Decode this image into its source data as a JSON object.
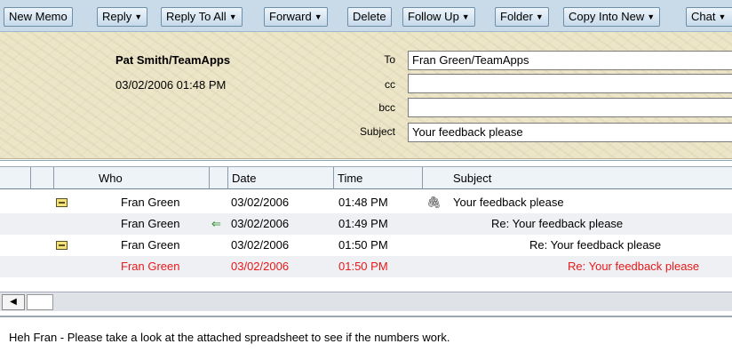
{
  "toolbar": {
    "buttons": [
      {
        "label": "New Memo",
        "dropdown": false
      },
      {
        "label": "Reply",
        "dropdown": true
      },
      {
        "label": "Reply To All",
        "dropdown": true
      },
      {
        "label": "Forward",
        "dropdown": true
      },
      {
        "label": "Delete",
        "dropdown": false
      },
      {
        "label": "Follow Up",
        "dropdown": true
      },
      {
        "label": "Folder",
        "dropdown": true
      },
      {
        "label": "Copy Into New",
        "dropdown": true
      },
      {
        "label": "Chat",
        "dropdown": true
      }
    ]
  },
  "memo": {
    "from": "Pat Smith/TeamApps",
    "sent": "03/02/2006 01:48 PM",
    "to_label": "To",
    "to_value": "Fran Green/TeamApps",
    "cc_label": "cc",
    "cc_value": "",
    "bcc_label": "bcc",
    "bcc_value": "",
    "subject_label": "Subject",
    "subject_value": "Your feedback please"
  },
  "thread": {
    "columns": [
      "Who",
      "Date",
      "Time",
      "Subject"
    ],
    "rows": [
      {
        "who": "Fran Green",
        "date": "03/02/2006",
        "time": "01:48 PM",
        "subject": "Your feedback please",
        "unread_icon": true,
        "reply_icon": false,
        "attachment": true,
        "highlight": false
      },
      {
        "who": "Fran Green",
        "date": "03/02/2006",
        "time": "01:49 PM",
        "subject": "Re: Your feedback please",
        "unread_icon": false,
        "reply_icon": true,
        "attachment": false,
        "highlight": false
      },
      {
        "who": "Fran Green",
        "date": "03/02/2006",
        "time": "01:50 PM",
        "subject": "Re: Your feedback please",
        "unread_icon": true,
        "reply_icon": false,
        "attachment": false,
        "highlight": false
      },
      {
        "who": "Fran Green",
        "date": "03/02/2006",
        "time": "01:50 PM",
        "subject": "Re: Your feedback please",
        "unread_icon": false,
        "reply_icon": false,
        "attachment": false,
        "highlight": true
      }
    ]
  },
  "body": {
    "text": "Heh Fran - Please take a look at the attached spreadsheet to see if the numbers work."
  },
  "colors": {
    "highlight_text": "#e8191a",
    "toolbar_bg": "#c9dbe8",
    "header_bg": "#ece5c8"
  }
}
